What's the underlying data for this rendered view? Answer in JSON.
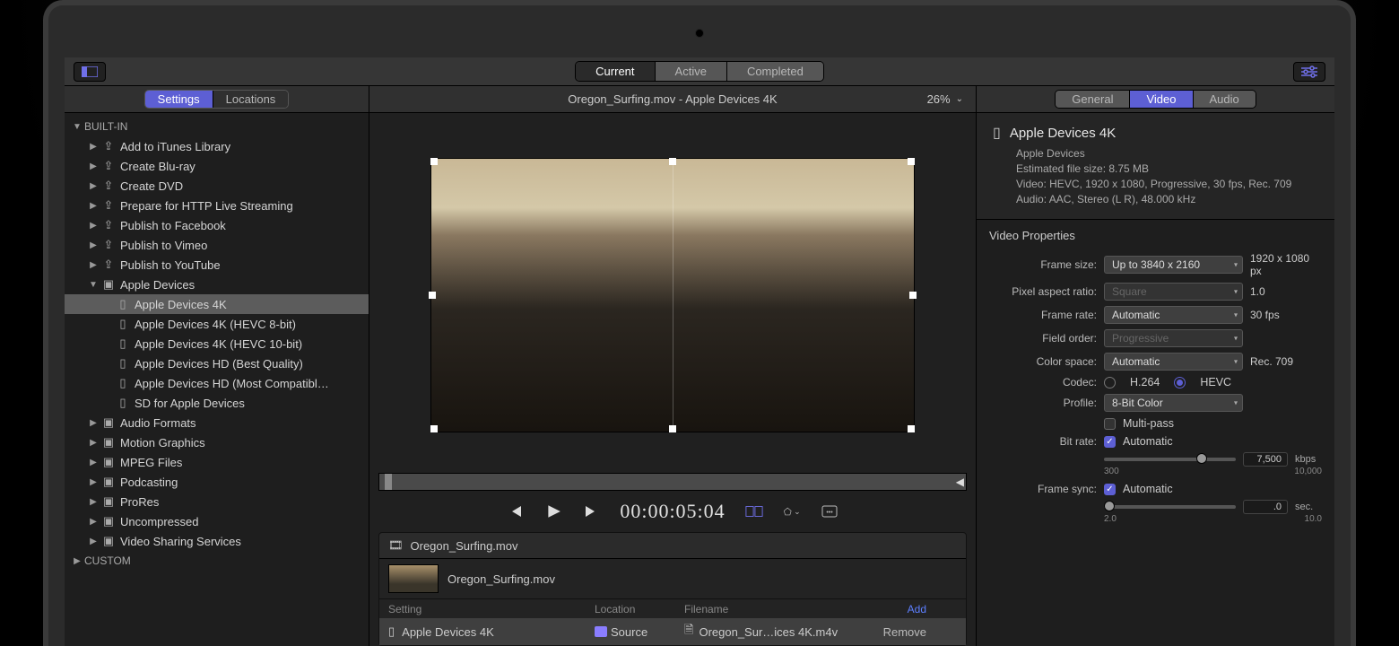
{
  "topTabs": {
    "current": "Current",
    "active": "Active",
    "completed": "Completed"
  },
  "sidebarTabs": {
    "settings": "Settings",
    "locations": "Locations"
  },
  "tree": {
    "builtIn": "BUILT-IN",
    "custom": "CUSTOM",
    "items": [
      "Add to iTunes Library",
      "Create Blu-ray",
      "Create DVD",
      "Prepare for HTTP Live Streaming",
      "Publish to Facebook",
      "Publish to Vimeo",
      "Publish to YouTube"
    ],
    "appleDevices": "Apple Devices",
    "presets": [
      "Apple Devices 4K",
      "Apple Devices 4K (HEVC 8-bit)",
      "Apple Devices 4K (HEVC 10-bit)",
      "Apple Devices HD (Best Quality)",
      "Apple Devices HD (Most Compatibl…",
      "SD for Apple Devices"
    ],
    "groups": [
      "Audio Formats",
      "Motion Graphics",
      "MPEG Files",
      "Podcasting",
      "ProRes",
      "Uncompressed",
      "Video Sharing Services"
    ]
  },
  "center": {
    "title": "Oregon_Surfing.mov - Apple Devices 4K",
    "zoom": "26%",
    "timecode": "00:00:05:04",
    "batchFile": "Oregon_Surfing.mov",
    "cols": {
      "setting": "Setting",
      "location": "Location",
      "filename": "Filename",
      "add": "Add"
    },
    "job": {
      "setting": "Apple Devices 4K",
      "location": "Source",
      "filename": "Oregon_Sur…ices 4K.m4v",
      "remove": "Remove"
    }
  },
  "inspector": {
    "tabs": {
      "general": "General",
      "video": "Video",
      "audio": "Audio"
    },
    "title": "Apple Devices 4K",
    "sub": "Apple Devices",
    "size": "Estimated file size: 8.75 MB",
    "videoLine": "Video: HEVC, 1920 x 1080, Progressive, 30 fps, Rec. 709",
    "audioLine": "Audio: AAC, Stereo (L R), 48.000 kHz",
    "section": "Video Properties",
    "frameSizeLabel": "Frame size:",
    "frameSize": "Up to 3840 x 2160",
    "frameSizeVal": "1920 x 1080 px",
    "pixelARLabel": "Pixel aspect ratio:",
    "pixelAR": "Square",
    "pixelARVal": "1.0",
    "frameRateLabel": "Frame rate:",
    "frameRate": "Automatic",
    "frameRateVal": "30 fps",
    "fieldOrderLabel": "Field order:",
    "fieldOrder": "Progressive",
    "colorSpaceLabel": "Color space:",
    "colorSpace": "Automatic",
    "colorSpaceVal": "Rec. 709",
    "codecLabel": "Codec:",
    "codec1": "H.264",
    "codec2": "HEVC",
    "profileLabel": "Profile:",
    "profile": "8-Bit Color",
    "multipass": "Multi-pass",
    "bitrateLabel": "Bit rate:",
    "automatic": "Automatic",
    "bitrateVal": "7,500",
    "bitrateUnit": "kbps",
    "bitrateMin": "300",
    "bitrateMax": "10,000",
    "frameSyncLabel": "Frame sync:",
    "syncVal": ".0",
    "syncUnit": "sec.",
    "syncMin": "2.0",
    "syncMax": "10.0"
  }
}
